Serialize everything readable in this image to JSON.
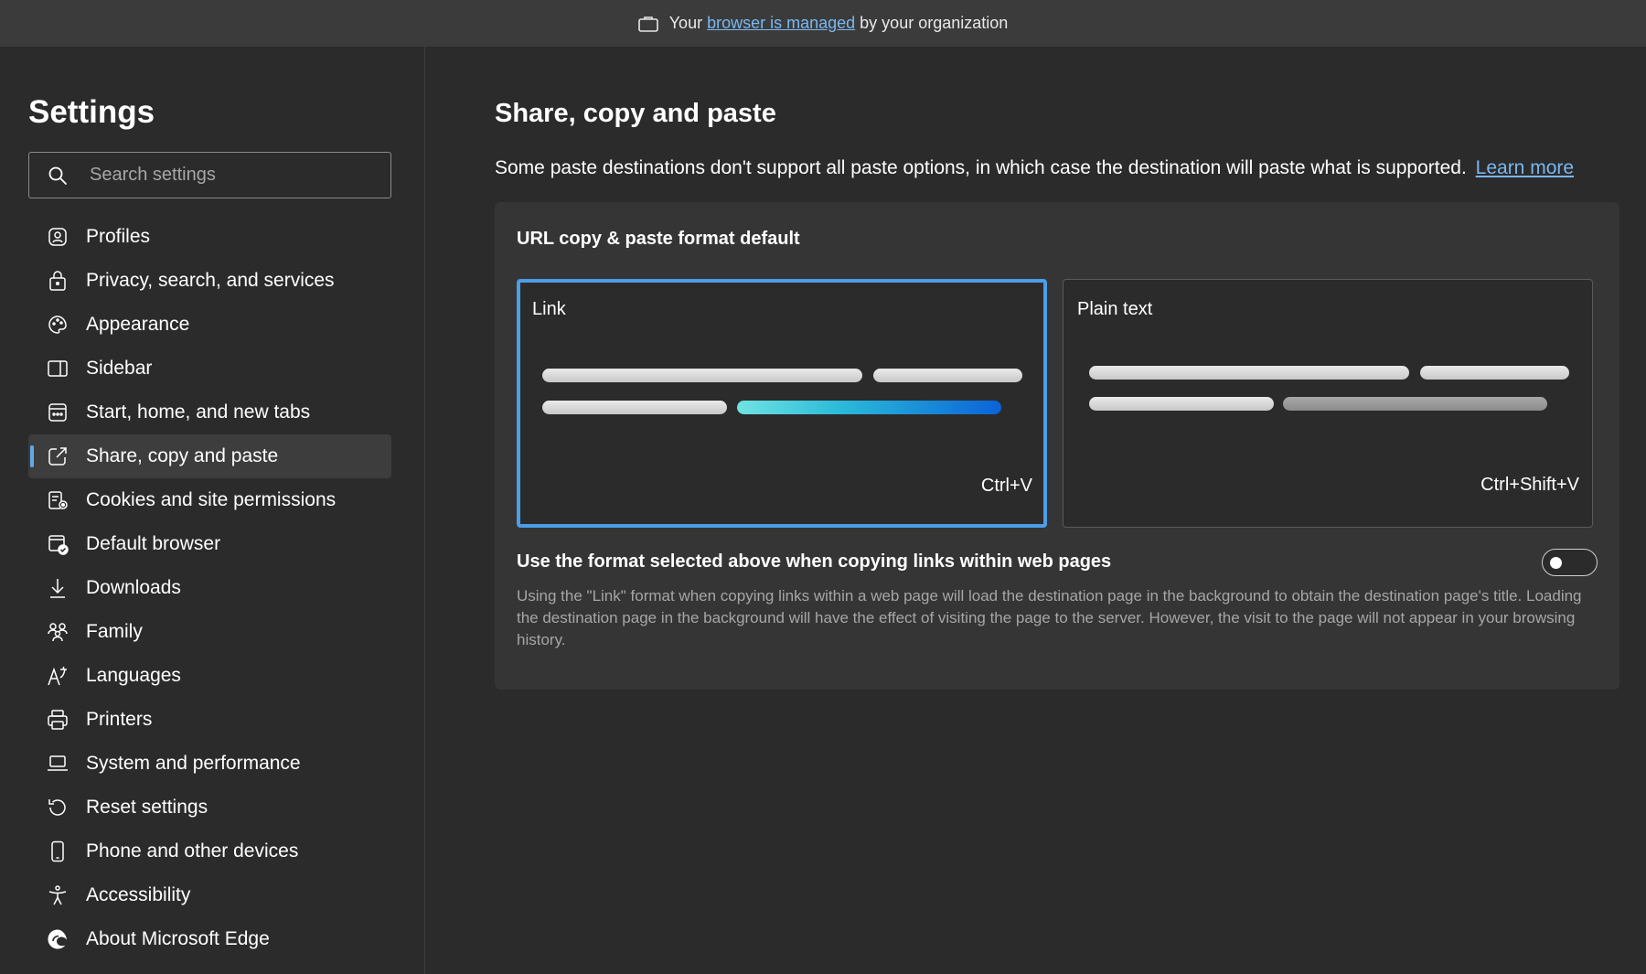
{
  "banner": {
    "prefix": "Your",
    "link": "browser is managed",
    "suffix": "by your organization"
  },
  "sidebar": {
    "title": "Settings",
    "search_placeholder": "Search settings",
    "items": [
      {
        "label": "Profiles",
        "icon": "profile-icon"
      },
      {
        "label": "Privacy, search, and services",
        "icon": "lock-icon"
      },
      {
        "label": "Appearance",
        "icon": "palette-icon"
      },
      {
        "label": "Sidebar",
        "icon": "sidebar-icon"
      },
      {
        "label": "Start, home, and new tabs",
        "icon": "home-tabs-icon"
      },
      {
        "label": "Share, copy and paste",
        "icon": "share-icon",
        "active": true
      },
      {
        "label": "Cookies and site permissions",
        "icon": "cookies-icon"
      },
      {
        "label": "Default browser",
        "icon": "default-browser-icon"
      },
      {
        "label": "Downloads",
        "icon": "download-icon"
      },
      {
        "label": "Family",
        "icon": "family-icon"
      },
      {
        "label": "Languages",
        "icon": "languages-icon"
      },
      {
        "label": "Printers",
        "icon": "printer-icon"
      },
      {
        "label": "System and performance",
        "icon": "laptop-icon"
      },
      {
        "label": "Reset settings",
        "icon": "reset-icon"
      },
      {
        "label": "Phone and other devices",
        "icon": "phone-icon"
      },
      {
        "label": "Accessibility",
        "icon": "accessibility-icon"
      },
      {
        "label": "About Microsoft Edge",
        "icon": "edge-icon"
      }
    ]
  },
  "main": {
    "title": "Share, copy and paste",
    "description": "Some paste destinations don't support all paste options, in which case the destination will paste what is supported.",
    "learn_more": "Learn more",
    "card": {
      "heading": "URL copy & paste format default",
      "options": [
        {
          "title": "Link",
          "shortcut": "Ctrl+V",
          "selected": true
        },
        {
          "title": "Plain text",
          "shortcut": "Ctrl+Shift+V",
          "selected": false
        }
      ],
      "setting_title": "Use the format selected above when copying links within web pages",
      "setting_description": "Using the \"Link\" format when copying links within a web page will load the destination page in the background to obtain the destination page's title. Loading the destination page in the background will have the effect of visiting the page to the server. However, the visit to the page will not appear in your browsing history.",
      "toggle_on": false
    }
  },
  "colors": {
    "accent": "#60a8ea",
    "link": "#7ab7f0",
    "background": "#2b2b2b",
    "card": "#353535"
  }
}
